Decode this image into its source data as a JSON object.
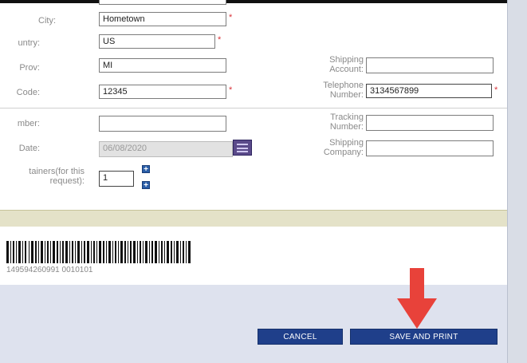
{
  "form": {
    "city": {
      "label": "City:",
      "value": "Hometown"
    },
    "country": {
      "label": "untry:",
      "value": "US"
    },
    "prov": {
      "label": "Prov:",
      "value": "MI"
    },
    "postal_code": {
      "label": "Code:",
      "value": "12345"
    },
    "number": {
      "label": "mber:",
      "value": ""
    },
    "date": {
      "label": "Date:",
      "value": "06/08/2020"
    },
    "containers": {
      "label_line1": "tainers(for this",
      "label_line2": "request):",
      "value": "1"
    },
    "shipping_account": {
      "label_line1": "Shipping",
      "label_line2": "Account:",
      "value": ""
    },
    "telephone": {
      "label_line1": "Telephone",
      "label_line2": "Number:",
      "value": "3134567899"
    },
    "tracking": {
      "label_line1": "Tracking",
      "label_line2": "Number:",
      "value": ""
    },
    "shipping_company": {
      "label_line1": "Shipping",
      "label_line2": "Company:",
      "value": ""
    },
    "required_mark": "*"
  },
  "stepper": {
    "up": "+",
    "down": "+"
  },
  "barcode": {
    "text": "149594260991 0010101"
  },
  "buttons": {
    "cancel": "CANCEL",
    "save_print": "SAVE AND PRINT"
  },
  "colors": {
    "button": "#1f3f8a",
    "arrow": "#e8423a",
    "required": "#d9343a"
  },
  "icons": {
    "calendar": "calendar-icon",
    "arrow": "arrow-down-icon"
  }
}
